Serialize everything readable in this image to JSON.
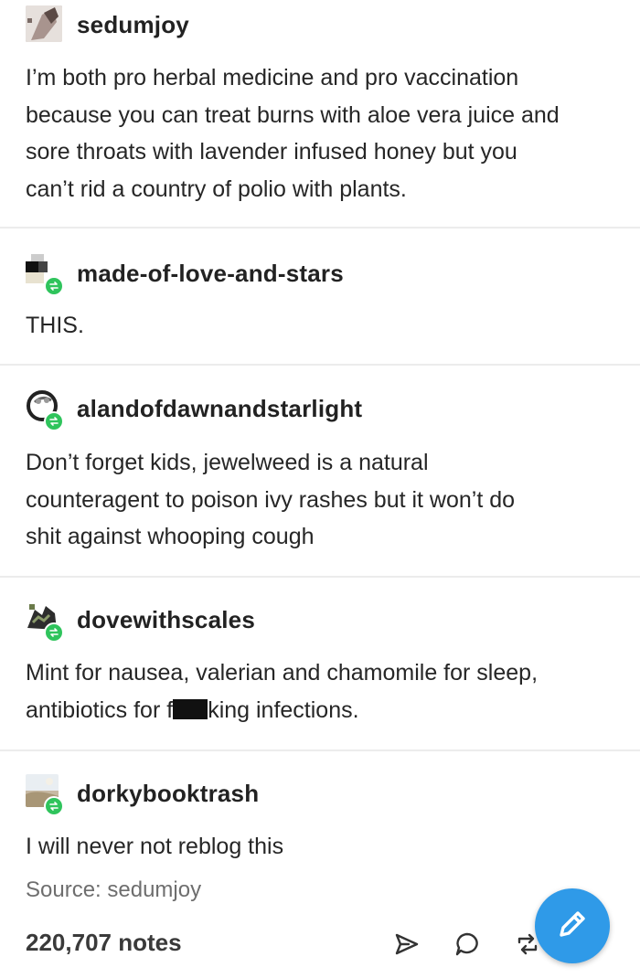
{
  "posts": [
    {
      "username": "sedumjoy",
      "text": "I’m both pro herbal medicine and pro vaccination\nbecause you can treat burns with aloe vera juice and\nsore throats with lavender infused honey but you\ncan’t rid a country of polio with plants."
    },
    {
      "username": "made-of-love-and-stars",
      "text": "THIS."
    },
    {
      "username": "alandofdawnandstarlight",
      "text": "Don’t forget kids, jewelweed is a natural\ncounteragent to poison ivy rashes but it won’t do\nshit against whooping cough"
    },
    {
      "username": "dovewithscales",
      "text_line1": "Mint for nausea, valerian and chamomile for sleep,",
      "text_line2_before": "antibiotics for f",
      "text_line2_after": "king infections."
    },
    {
      "username": "dorkybooktrash",
      "text": "I will never not reblog this"
    }
  ],
  "footer": {
    "source": "Source: sedumjoy",
    "notes": "220,707 notes"
  },
  "icons": {
    "share": "share-icon",
    "reply": "reply-icon",
    "reblog": "reblog-icon",
    "compose": "pencil-icon"
  },
  "colors": {
    "reblog_badge": "#2fc45c",
    "fab": "#2f9ae8",
    "divider": "#ececec"
  }
}
